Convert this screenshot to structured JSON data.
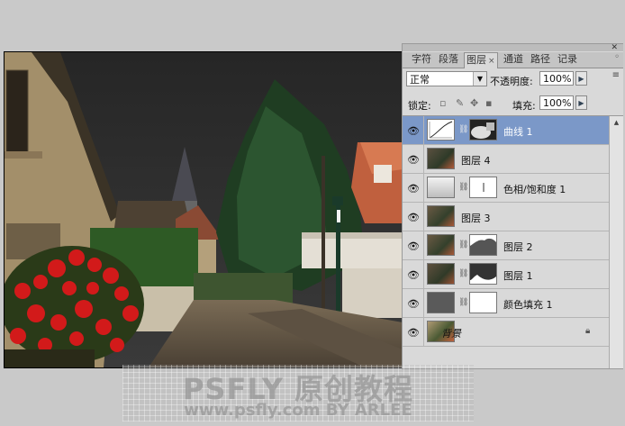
{
  "panel": {
    "tabs": [
      {
        "label": "字符"
      },
      {
        "label": "段落"
      },
      {
        "label": "图层",
        "close": "×"
      },
      {
        "label": "通道"
      },
      {
        "label": "路径"
      },
      {
        "label": "记录"
      }
    ],
    "menu_glyph": "◦",
    "close_glyph": "✕",
    "menu_glyph2": "≡",
    "blend_mode": "正常",
    "opacity_label": "不透明度:",
    "opacity_value": "100%",
    "lock_label": "锁定:",
    "fill_label": "填充:",
    "fill_value": "100%",
    "layers": [
      {
        "name": "曲线 1",
        "selected": true,
        "thumb": "curves-adjustment",
        "mask": "curves-mask"
      },
      {
        "name": "图层 4",
        "selected": false,
        "thumb": "photo"
      },
      {
        "name": "色相/饱和度 1",
        "selected": false,
        "thumb": "hue-saturation-adjustment",
        "mask": "hue-mask"
      },
      {
        "name": "图层 3",
        "selected": false,
        "thumb": "photo"
      },
      {
        "name": "图层 2",
        "selected": false,
        "thumb": "photo",
        "mask": "layer2-mask"
      },
      {
        "name": "图层 1",
        "selected": false,
        "thumb": "photo",
        "mask": "layer1-mask"
      },
      {
        "name": "颜色填充 1",
        "selected": false,
        "thumb": "solid-gray",
        "mask": "white-mask"
      },
      {
        "name": "背景",
        "selected": false,
        "thumb": "photo",
        "locked": true
      }
    ],
    "selected_color": "#7b98c8"
  },
  "watermark": {
    "line1": "PSFLY 原创教程",
    "line2": "www.psfly.com BY ARLEE"
  }
}
